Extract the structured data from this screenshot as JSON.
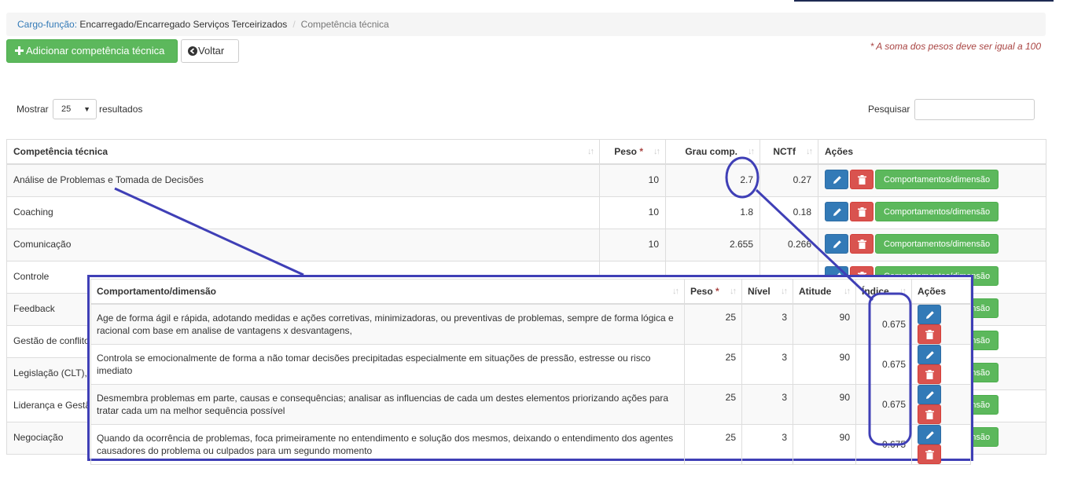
{
  "breadcrumb": {
    "prefix": "Cargo-função:",
    "role": " Encarregado/Encarregado Serviços Terceirizados",
    "separator": "/",
    "current": "Competência técnica"
  },
  "toolbar": {
    "add_label": "Adicionar competência técnica",
    "back_label": "Voltar"
  },
  "note": "* A soma dos pesos deve ser igual a 100",
  "length": {
    "before": "Mostrar",
    "value": "25",
    "after": "resultados"
  },
  "search": {
    "label": "Pesquisar",
    "value": ""
  },
  "main_table": {
    "headers": [
      "Competência técnica",
      "Peso",
      "Grau comp.",
      "NCTf",
      "Ações"
    ],
    "required_mark": "*",
    "action_label": "Comportamentos/dimensão",
    "rows": [
      {
        "name": "Análise de Problemas e Tomada de Decisões",
        "peso": "10",
        "grau": "2.7",
        "nctf": "0.27"
      },
      {
        "name": "Coaching",
        "peso": "10",
        "grau": "1.8",
        "nctf": "0.18"
      },
      {
        "name": "Comunicação",
        "peso": "10",
        "grau": "2.655",
        "nctf": "0.266"
      },
      {
        "name": "Controle",
        "peso": "",
        "grau": "",
        "nctf": ""
      },
      {
        "name": "Feedback",
        "peso": "",
        "grau": "",
        "nctf": ""
      },
      {
        "name": "Gestão de conflito",
        "peso": "",
        "grau": "",
        "nctf": ""
      },
      {
        "name": "Legislação (CLT), C",
        "peso": "",
        "grau": "",
        "nctf": ""
      },
      {
        "name": "Liderança e Gestã",
        "peso": "",
        "grau": "",
        "nctf": ""
      },
      {
        "name": "Negociação",
        "peso": "",
        "grau": "",
        "nctf": ""
      }
    ],
    "partial_action_label": "nsão"
  },
  "sub_table": {
    "headers": [
      "Comportamento/dimensão",
      "Peso",
      "Nível",
      "Atitude",
      "Índice",
      "Ações"
    ],
    "required_mark": "*",
    "rows": [
      {
        "text": "Age de forma ágil e rápida, adotando medidas e ações corretivas, minimizadoras, ou preventivas de problemas, sempre de forma lógica e racional com base em analise de vantagens x desvantagens,",
        "peso": "25",
        "nivel": "3",
        "atitude": "90",
        "indice": "0.675"
      },
      {
        "text": "Controla se emocionalmente de forma a não tomar decisões precipitadas especialmente em situações de pressão, estresse ou risco imediato",
        "peso": "25",
        "nivel": "3",
        "atitude": "90",
        "indice": "0.675"
      },
      {
        "text": "Desmembra problemas em parte, causas e consequências; analisar as influencias de cada um destes elementos priorizando ações para tratar cada um na melhor sequência possível",
        "peso": "25",
        "nivel": "3",
        "atitude": "90",
        "indice": "0.675"
      },
      {
        "text": "Quando da ocorrência de problemas, foca primeiramente no entendimento e solução dos mesmos, deixando o entendimento dos agentes causadores do problema ou culpados para um segundo momento",
        "peso": "25",
        "nivel": "3",
        "atitude": "90",
        "indice": "0.675"
      }
    ]
  },
  "colors": {
    "annotation": "#3f3fb6",
    "primary": "#337ab7",
    "success": "#5cb85c",
    "danger": "#d9534f",
    "required": "#a94442"
  },
  "icons": [
    "plus-icon",
    "arrow-left-circle-icon",
    "pencil-icon",
    "trash-icon",
    "sort-icon",
    "dropdown-caret-icon"
  ]
}
